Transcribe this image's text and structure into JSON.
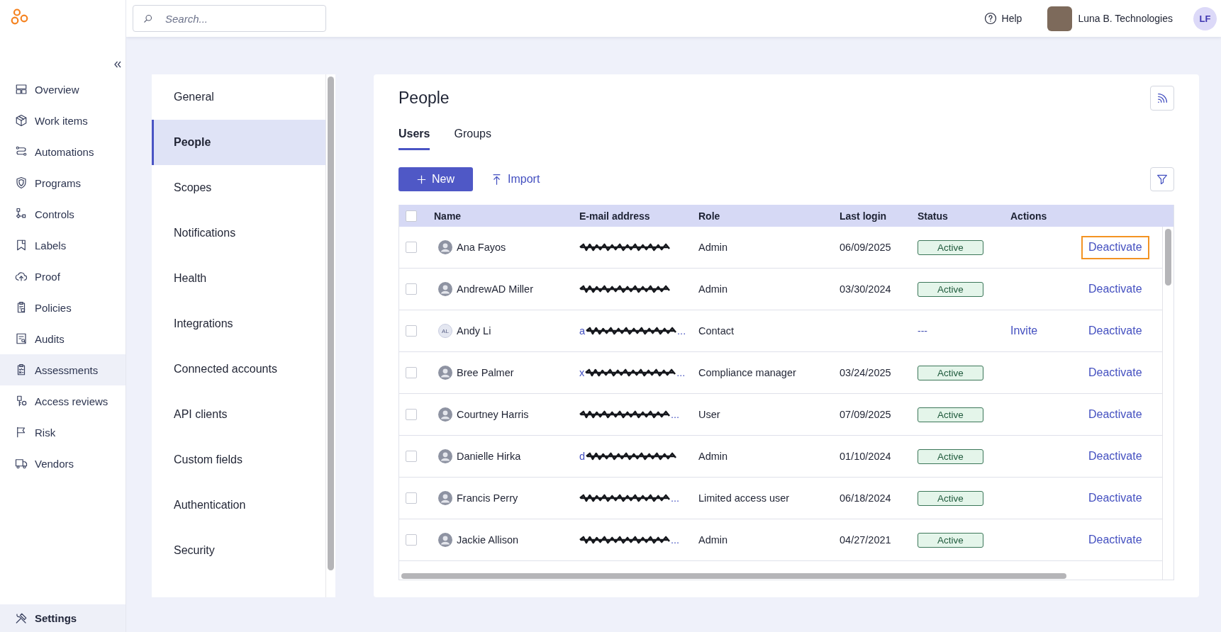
{
  "sidebar": {
    "items": [
      {
        "label": "Overview",
        "selected": false,
        "hovered": false
      },
      {
        "label": "Work items",
        "selected": false,
        "hovered": false
      },
      {
        "label": "Automations",
        "selected": false,
        "hovered": false
      },
      {
        "label": "Programs",
        "selected": false,
        "hovered": false
      },
      {
        "label": "Controls",
        "selected": false,
        "hovered": false
      },
      {
        "label": "Labels",
        "selected": false,
        "hovered": false
      },
      {
        "label": "Proof",
        "selected": false,
        "hovered": false
      },
      {
        "label": "Policies",
        "selected": false,
        "hovered": false
      },
      {
        "label": "Audits",
        "selected": false,
        "hovered": false
      },
      {
        "label": "Assessments",
        "selected": false,
        "hovered": true
      },
      {
        "label": "Access reviews",
        "selected": false,
        "hovered": false
      },
      {
        "label": "Risk",
        "selected": false,
        "hovered": false
      },
      {
        "label": "Vendors",
        "selected": false,
        "hovered": false
      }
    ],
    "footer_item": {
      "label": "Settings",
      "selected": true
    }
  },
  "top_bar": {
    "search": {
      "placeholder": "Search..."
    },
    "help": "Help",
    "organization": "Luna B. Technologies",
    "user_initials": "LF"
  },
  "settings_menu": {
    "items": [
      {
        "label": "General",
        "selected": false
      },
      {
        "label": "People",
        "selected": true
      },
      {
        "label": "Scopes",
        "selected": false
      },
      {
        "label": "Notifications",
        "selected": false
      },
      {
        "label": "Health",
        "selected": false
      },
      {
        "label": "Integrations",
        "selected": false
      },
      {
        "label": "Connected accounts",
        "selected": false
      },
      {
        "label": "API clients",
        "selected": false
      },
      {
        "label": "Custom fields",
        "selected": false
      },
      {
        "label": "Authentication",
        "selected": false
      },
      {
        "label": "Security",
        "selected": false
      }
    ]
  },
  "page": {
    "title": "People",
    "tabs": [
      {
        "label": "Users",
        "selected": true
      },
      {
        "label": "Groups",
        "selected": false
      }
    ],
    "new_button": "New",
    "import_button": "Import",
    "table": {
      "header_checkbox": {
        "checked": false
      },
      "columns": [
        "Name",
        "E-mail address",
        "Role",
        "Last login",
        "Status",
        "Actions"
      ],
      "rows": [
        {
          "checked": false,
          "avatar": {
            "kind": "photo"
          },
          "name": "Ana Fayos",
          "email": {
            "redacted": true
          },
          "role": "Admin",
          "last_login": "06/09/2025",
          "status": {
            "kind": "badge",
            "text": "Active"
          },
          "deactivate": "Deactivate",
          "focused": true
        },
        {
          "checked": false,
          "avatar": {
            "kind": "photo"
          },
          "name": "AndrewAD Miller",
          "email": {
            "redacted": true
          },
          "role": "Admin",
          "last_login": "03/30/2024",
          "status": {
            "kind": "badge",
            "text": "Active"
          },
          "deactivate": "Deactivate",
          "focused": false
        },
        {
          "checked": false,
          "avatar": {
            "kind": "initials",
            "initials": "AL"
          },
          "name": "Andy Li",
          "email": {
            "redacted": true,
            "start": "a",
            "end": "..."
          },
          "role": "Contact",
          "status": {
            "kind": "plain",
            "text": "---"
          },
          "invite": "Invite",
          "deactivate": "Deactivate",
          "focused": false
        },
        {
          "checked": false,
          "avatar": {
            "kind": "photo"
          },
          "name": "Bree Palmer",
          "email": {
            "redacted": true,
            "start": "x",
            "end": "..."
          },
          "role": "Compliance manager",
          "last_login": "03/24/2025",
          "status": {
            "kind": "badge",
            "text": "Active"
          },
          "deactivate": "Deactivate",
          "focused": false
        },
        {
          "checked": false,
          "avatar": {
            "kind": "photo"
          },
          "name": "Courtney Harris",
          "email": {
            "redacted": true,
            "end": "..."
          },
          "role": "User",
          "last_login": "07/09/2025",
          "status": {
            "kind": "badge",
            "text": "Active"
          },
          "deactivate": "Deactivate",
          "focused": false
        },
        {
          "checked": false,
          "avatar": {
            "kind": "photo"
          },
          "name": "Danielle Hirka",
          "email": {
            "redacted": true,
            "start": "d"
          },
          "role": "Admin",
          "last_login": "01/10/2024",
          "status": {
            "kind": "badge",
            "text": "Active"
          },
          "deactivate": "Deactivate",
          "focused": false
        },
        {
          "checked": false,
          "avatar": {
            "kind": "photo"
          },
          "name": "Francis Perry",
          "email": {
            "redacted": true,
            "end": "..."
          },
          "role": "Limited access user",
          "last_login": "06/18/2024",
          "status": {
            "kind": "badge",
            "text": "Active"
          },
          "deactivate": "Deactivate",
          "focused": false
        },
        {
          "checked": false,
          "avatar": {
            "kind": "photo"
          },
          "name": "Jackie Allison",
          "email": {
            "redacted": true,
            "end": "..."
          },
          "role": "Admin",
          "last_login": "04/27/2021",
          "status": {
            "kind": "badge",
            "text": "Active"
          },
          "deactivate": "Deactivate",
          "focused": false
        }
      ]
    }
  }
}
